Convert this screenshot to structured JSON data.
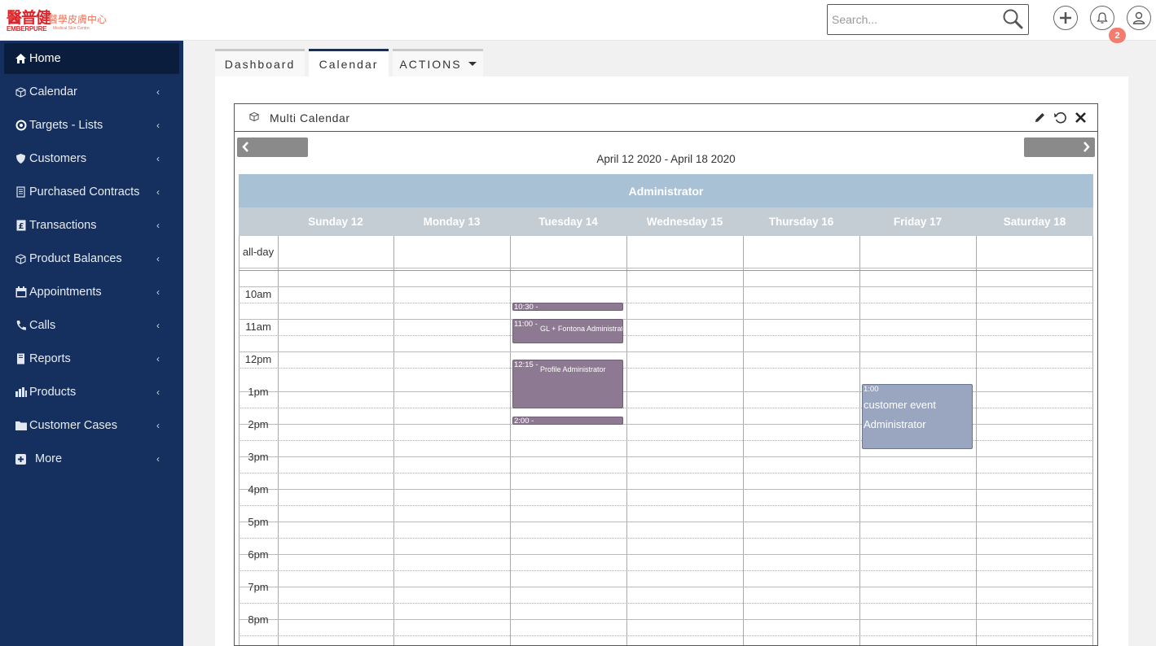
{
  "brand": {
    "logo_cn": "醫普健",
    "logo_sub_cn": "醫學皮膚中心",
    "logo_en": "EMBERPURE",
    "logo_en_sub": "Medical Skin Centre"
  },
  "header": {
    "search_placeholder": "Search...",
    "notification_count": "2",
    "icons": [
      "plus-circle-icon",
      "bell-icon",
      "user-icon"
    ]
  },
  "sidebar": {
    "items": [
      {
        "label": "Home",
        "icon": "home-icon",
        "active": true
      },
      {
        "label": "Calendar",
        "icon": "cube-icon"
      },
      {
        "label": "Targets - Lists",
        "icon": "target-icon"
      },
      {
        "label": "Customers",
        "icon": "shield-icon"
      },
      {
        "label": "Purchased Contracts",
        "icon": "document-icon"
      },
      {
        "label": "Transactions",
        "icon": "currency-icon"
      },
      {
        "label": "Product Balances",
        "icon": "cube-icon"
      },
      {
        "label": "Appointments",
        "icon": "calendar-icon"
      },
      {
        "label": "Calls",
        "icon": "phone-icon"
      },
      {
        "label": "Reports",
        "icon": "book-icon"
      },
      {
        "label": "Products",
        "icon": "bar-chart-icon"
      },
      {
        "label": "Customer Cases",
        "icon": "folder-icon"
      },
      {
        "label": "More",
        "icon": "plus-square-icon"
      }
    ]
  },
  "tabs": [
    {
      "label": "Dashboard"
    },
    {
      "label": "Calendar",
      "active": true
    },
    {
      "label": "ACTIONS"
    }
  ],
  "widget": {
    "title": "Multi Calendar",
    "date_range": "April 12 2020 - April 18 2020",
    "resource": "Administrator",
    "days": [
      "Sunday 12",
      "Monday 13",
      "Tuesday 14",
      "Wednesday 15",
      "Thursday 16",
      "Friday 17",
      "Saturday 18"
    ],
    "all_day_label": "all-day",
    "hours": [
      "10am",
      "11am",
      "12pm",
      "1pm",
      "2pm",
      "3pm",
      "4pm",
      "5pm",
      "6pm",
      "7pm",
      "8pm"
    ],
    "events": [
      {
        "time": "10:30 -",
        "title": ""
      },
      {
        "time": "11:00 -",
        "title": "GL + Fontona Administrator"
      },
      {
        "time": "12:15 -",
        "title": "Profile Administrator"
      },
      {
        "time": "2:00 -",
        "title": ""
      },
      {
        "time": "1:00",
        "title": "customer event",
        "subtitle": "Administrator"
      }
    ]
  },
  "colors": {
    "sidebar_bg": "#152f5e",
    "sidebar_active_bg": "#0b1d3d",
    "resource_bar": "#a9c1d5",
    "day_header": "#c5cdd4",
    "event_purple": "#8d7a92",
    "event_blue": "#9aa5bf",
    "badge": "#f27c6e"
  }
}
